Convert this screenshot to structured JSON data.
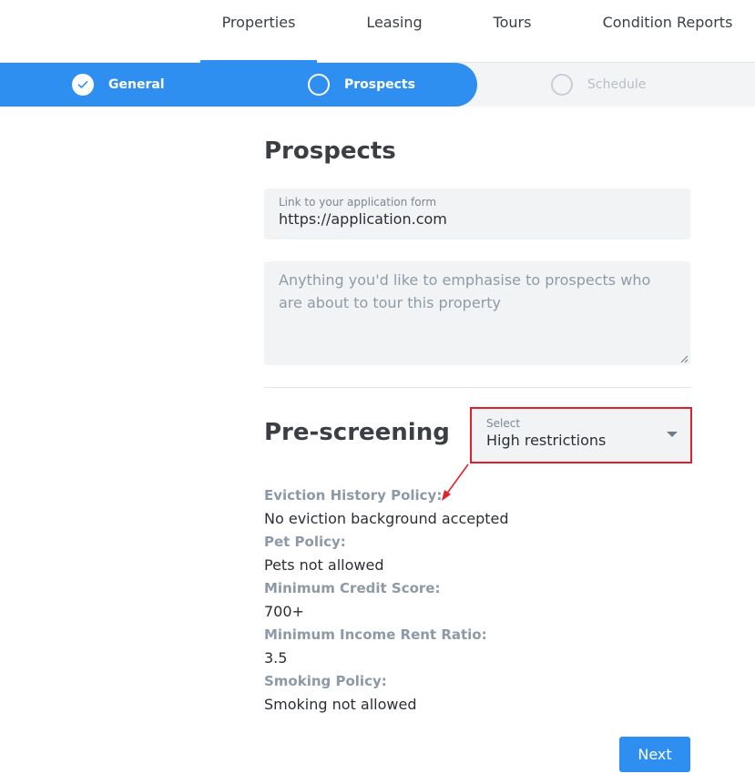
{
  "topnav": {
    "tabs": [
      {
        "label": "Properties",
        "active": true
      },
      {
        "label": "Leasing",
        "active": false
      },
      {
        "label": "Tours",
        "active": false
      },
      {
        "label": "Condition Reports",
        "active": false
      }
    ]
  },
  "stepper": {
    "steps": [
      {
        "label": "General",
        "state": "done"
      },
      {
        "label": "Prospects",
        "state": "current"
      },
      {
        "label": "Schedule",
        "state": "todo"
      }
    ]
  },
  "prospects": {
    "title": "Prospects",
    "link_field": {
      "label": "Link to your application form",
      "value": "https://application.com"
    },
    "notes_field": {
      "placeholder": "Anything you'd like to emphasise to prospects who are about to tour this property"
    }
  },
  "prescreening": {
    "title": "Pre-screening",
    "select": {
      "label": "Select",
      "value": "High restrictions"
    },
    "policies": [
      {
        "label": "Eviction History Policy:",
        "value": "No eviction background accepted"
      },
      {
        "label": "Pet Policy:",
        "value": "Pets not allowed"
      },
      {
        "label": "Minimum Credit Score:",
        "value": "700+"
      },
      {
        "label": "Minimum Income Rent Ratio:",
        "value": "3.5"
      },
      {
        "label": "Smoking Policy:",
        "value": "Smoking not allowed"
      }
    ]
  },
  "actions": {
    "next_label": "Next"
  },
  "colors": {
    "accent": "#2e8ff0",
    "annotation": "#e0202a"
  }
}
